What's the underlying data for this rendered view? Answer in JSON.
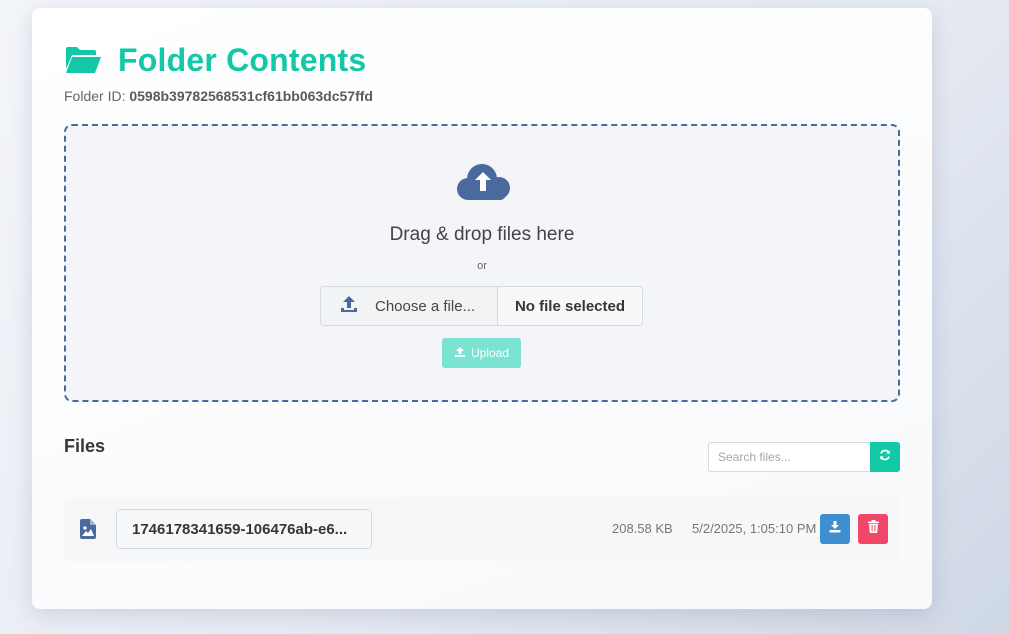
{
  "header": {
    "title": "Folder Contents",
    "folder_id_label": "Folder ID:",
    "folder_id": "0598b39782568531cf61bb063dc57ffd"
  },
  "dropzone": {
    "icon": "cloud-upload-icon",
    "text": "Drag & drop files here",
    "or": "or",
    "choose_label": "Choose a file...",
    "no_file": "No file selected",
    "upload_label": "Upload"
  },
  "files": {
    "title": "Files",
    "search_placeholder": "Search files...",
    "rows": [
      {
        "name": "1746178341659-106476ab-e6...",
        "size": "208.58 KB",
        "date": "5/2/2025, 1:05:10 PM",
        "icon": "image-file-icon"
      }
    ]
  },
  "colors": {
    "accent": "#12c8a7",
    "primary": "#4a6a9e",
    "info": "#3e8ed0",
    "danger": "#f14668"
  }
}
